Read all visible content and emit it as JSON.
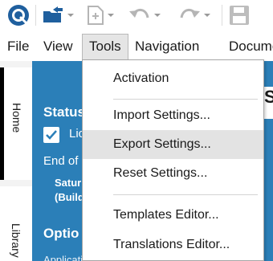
{
  "toolbar": {
    "icons": [
      "app-logo-icon",
      "open-folder-icon",
      "new-file-icon",
      "undo-icon",
      "redo-icon",
      "save-icon"
    ]
  },
  "menubar": {
    "items": [
      "File",
      "View",
      "Tools",
      "Navigation",
      "Documer"
    ]
  },
  "tools_menu": {
    "items": [
      {
        "label": "Activation"
      },
      {
        "label": "Import Settings..."
      },
      {
        "label": "Export Settings..."
      },
      {
        "label": "Reset Settings..."
      },
      {
        "label": "Templates Editor..."
      },
      {
        "label": "Translations Editor..."
      }
    ],
    "highlighted": "Export Settings..."
  },
  "side_tabs": {
    "home": "Home",
    "library": "Library"
  },
  "panel": {
    "status_title": "Status",
    "license_label": "Lic",
    "end_label": "End of l",
    "date_line1": "Satur",
    "date_line2": "(Build",
    "options_title": "Optio",
    "app_label": "Applicati",
    "right_letter": "S"
  },
  "colors": {
    "panel_blue": "#2b7fb8",
    "hover_gray": "#e3e3e3",
    "logo_blue": "#1f5f9e"
  }
}
